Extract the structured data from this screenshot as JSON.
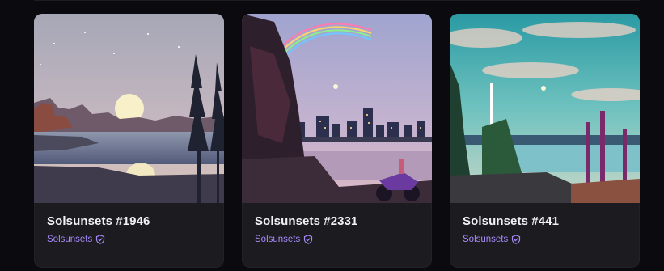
{
  "cards": [
    {
      "title": "Solsunsets #1946",
      "collection": "Solsunsets",
      "verified_icon": "verified-badge-icon",
      "image": "pixel-art-sunset-lake"
    },
    {
      "title": "Solsunsets #2331",
      "collection": "Solsunsets",
      "verified_icon": "verified-badge-icon",
      "image": "pixel-art-city-rainbow-motorcycle"
    },
    {
      "title": "Solsunsets #441",
      "collection": "Solsunsets",
      "verified_icon": "verified-badge-icon",
      "image": "pixel-art-ruins-teal-sky"
    }
  ],
  "colors": {
    "background": "#0b0b0f",
    "card": "#1b1b20",
    "accent": "#a78bfa",
    "text": "#f2f2f7"
  }
}
